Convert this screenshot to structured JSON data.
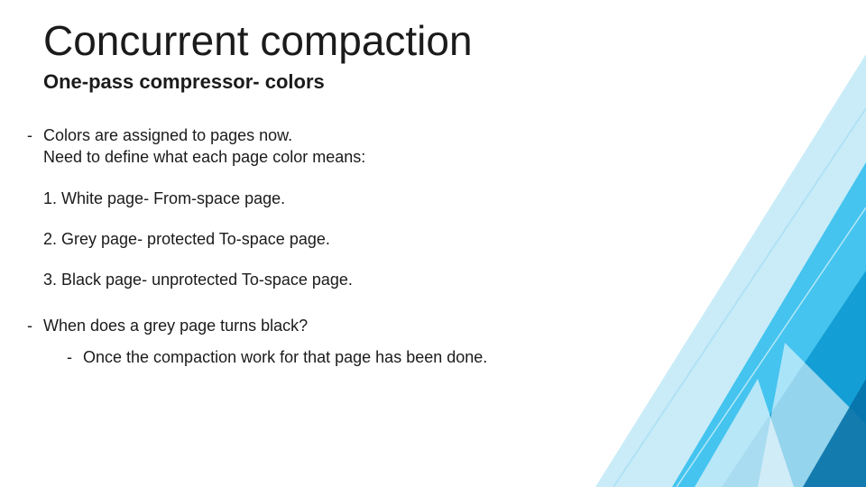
{
  "title": "Concurrent compaction",
  "subtitle": "One-pass compressor- colors",
  "intro_line1": "Colors are assigned to pages now.",
  "intro_line2": "Need to define what each page color means:",
  "items": [
    "1. White page- From-space page.",
    "2. Grey page- protected To-space page.",
    "3. Black page- unprotected To-space page."
  ],
  "question": "When does a grey page turns black?",
  "answer": "Once the compaction work for that page has been done.",
  "dash": "-"
}
